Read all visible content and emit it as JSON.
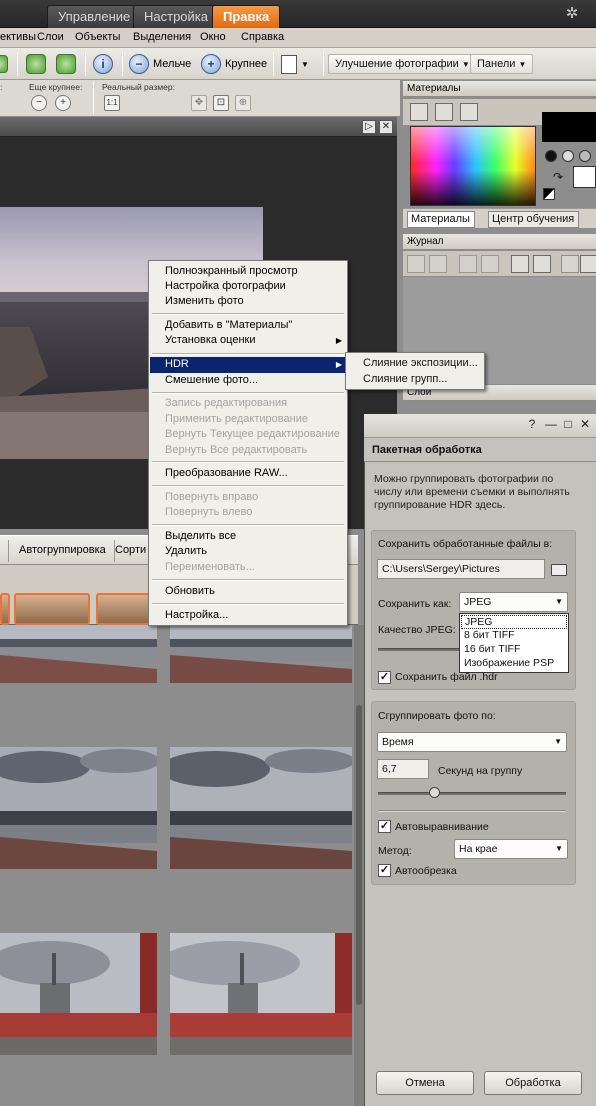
{
  "tabs": [
    {
      "label": "Управление"
    },
    {
      "label": "Настройка"
    },
    {
      "label": "Правка"
    }
  ],
  "menu": [
    "ективы",
    "Слои",
    "Объекты",
    "Выделения",
    "Окно",
    "Справка"
  ],
  "toolbar": {
    "zoom_out": "Мельче",
    "zoom_in": "Крупнее",
    "enhance": "Улучшение фотографии",
    "panels": "Панели"
  },
  "subbar": {
    "more_larger": "Еще крупнее:",
    "real_size": "Реальный размер:"
  },
  "organizer": {
    "autogroup": "Автогруппировка",
    "sort": "Сорти"
  },
  "panels": {
    "materials": "Материалы",
    "materials_tab": "Материалы",
    "learning_tab": "Центр обучения",
    "journal": "Журнал",
    "layers": "Слои"
  },
  "context_menu": {
    "items": [
      {
        "label": "Полноэкранный просмотр",
        "state": "normal"
      },
      {
        "label": "Настройка фотографии",
        "state": "normal"
      },
      {
        "label": "Изменить фото",
        "state": "normal"
      },
      {
        "label": "Добавить в \"Материалы\"",
        "state": "normal"
      },
      {
        "label": "Установка оценки",
        "state": "normal"
      },
      {
        "label": "HDR",
        "state": "highlighted"
      },
      {
        "label": "Смешение фото...",
        "state": "normal"
      },
      {
        "label": "Запись редактирования",
        "state": "disabled"
      },
      {
        "label": "Применить редактирование",
        "state": "disabled"
      },
      {
        "label": "Вернуть Текущее редактирование",
        "state": "disabled"
      },
      {
        "label": "Вернуть Все редактировать",
        "state": "disabled"
      },
      {
        "label": "Преобразование RAW...",
        "state": "normal"
      },
      {
        "label": "Повернуть вправо",
        "state": "disabled"
      },
      {
        "label": "Повернуть влево",
        "state": "disabled"
      },
      {
        "label": "Выделить все",
        "state": "normal"
      },
      {
        "label": "Удалить",
        "state": "normal"
      },
      {
        "label": "Переименовать...",
        "state": "disabled"
      },
      {
        "label": "Обновить",
        "state": "normal"
      },
      {
        "label": "Настройка...",
        "state": "normal"
      }
    ],
    "submenu": [
      {
        "label": "Слияние экспозиции..."
      },
      {
        "label": "Слияние групп..."
      }
    ]
  },
  "dialog": {
    "controls": [
      "?",
      "—",
      "□",
      "✕"
    ],
    "title": "Пакетная обработка",
    "description": "Можно группировать фотографии по числу или времени съемки и выполнять группирование HDR здесь.",
    "save_to_label": "Сохранить обработанные файлы в:",
    "save_path": "C:\\Users\\Sergey\\Pictures",
    "save_as_label": "Сохранить как:",
    "save_as_value": "JPEG",
    "quality_label": "Качество JPEG:",
    "format_options": [
      "JPEG",
      "8 бит TIFF",
      "16 бит TIFF",
      "Изображение PSP"
    ],
    "save_hdr_label": "Сохранить файл .hdr",
    "save_hdr_checked": true,
    "group_by_label": "Сгруппировать фото по:",
    "group_by_value": "Время",
    "seconds_value": "6,7",
    "seconds_label": "Секунд на группу",
    "seconds_slider": 0.3,
    "autoalign_label": "Автовыравнивание",
    "autoalign_checked": true,
    "method_label": "Метод:",
    "method_value": "На крае",
    "autocrop_label": "Автообрезка",
    "autocrop_checked": true,
    "cancel": "Отмена",
    "process": "Обработка"
  },
  "colors": {
    "accent_tab": "#e06a12",
    "menu_highlight": "#0b2470"
  }
}
